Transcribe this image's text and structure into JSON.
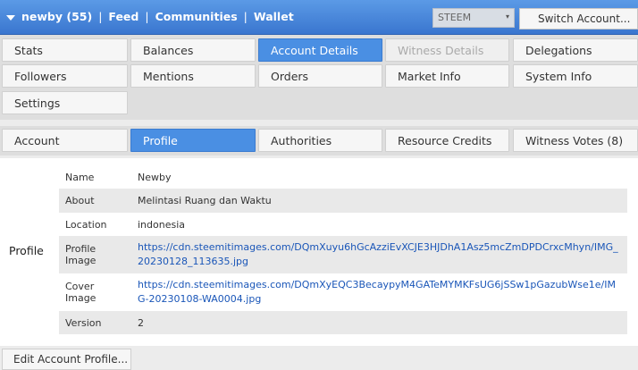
{
  "topbar": {
    "user": "newby (55)",
    "links": [
      "Feed",
      "Communities",
      "Wallet"
    ],
    "separator": "|",
    "coin": "STEEM",
    "switch_account": "Switch Account..."
  },
  "main_tabs": [
    {
      "label": "Stats",
      "state": "normal"
    },
    {
      "label": "Balances",
      "state": "normal"
    },
    {
      "label": "Account Details",
      "state": "active"
    },
    {
      "label": "Witness Details",
      "state": "disabled"
    },
    {
      "label": "Delegations",
      "state": "normal"
    },
    {
      "label": "Followers",
      "state": "normal"
    },
    {
      "label": "Mentions",
      "state": "normal"
    },
    {
      "label": "Orders",
      "state": "normal"
    },
    {
      "label": "Market Info",
      "state": "normal"
    },
    {
      "label": "System Info",
      "state": "normal"
    },
    {
      "label": "Settings",
      "state": "normal"
    }
  ],
  "sub_tabs": [
    {
      "label": "Account",
      "state": "normal"
    },
    {
      "label": "Profile",
      "state": "active"
    },
    {
      "label": "Authorities",
      "state": "normal"
    },
    {
      "label": "Resource Credits",
      "state": "normal"
    },
    {
      "label": "Witness Votes (8)",
      "state": "normal"
    }
  ],
  "profile": {
    "section_label": "Profile",
    "rows": [
      {
        "key": "Name",
        "value": "Newby"
      },
      {
        "key": "About",
        "value": "Melintasi Ruang dan Waktu"
      },
      {
        "key": "Location",
        "value": "indonesia"
      },
      {
        "key": "Profile Image",
        "value": "https://cdn.steemitimages.com/DQmXuyu6hGcAzziEvXCJE3HJDhA1Asz5mcZmDPDCrxcMhyn/IMG_20230128_113635.jpg",
        "link": true
      },
      {
        "key": "Cover Image",
        "value": "https://cdn.steemitimages.com/DQmXyEQC3BecaypyM4GATeMYMKFsUG6jSSw1pGazubWse1e/IMG-20230108-WA0004.jpg",
        "link": true
      },
      {
        "key": "Version",
        "value": "2"
      }
    ]
  },
  "edit_profile": "Edit Account Profile..."
}
